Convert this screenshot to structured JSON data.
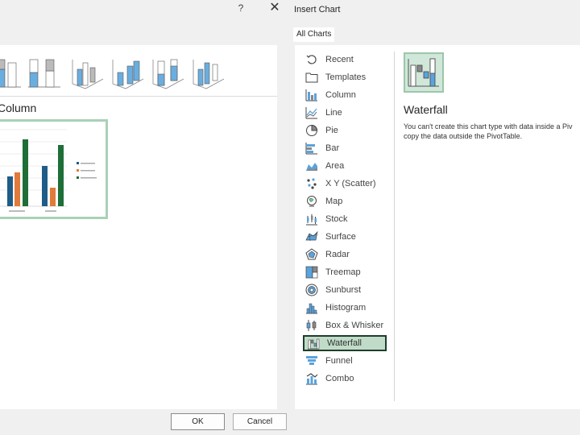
{
  "left_dialog": {
    "help_label": "?",
    "close_label": "✕",
    "heading": "Column",
    "ok_label": "OK",
    "cancel_label": "Cancel"
  },
  "right_dialog": {
    "title": "Insert Chart",
    "tab_label": "All Charts",
    "chart_types": [
      {
        "label": "Recent",
        "icon": "recent-icon"
      },
      {
        "label": "Templates",
        "icon": "templates-icon"
      },
      {
        "label": "Column",
        "icon": "column-chart-icon"
      },
      {
        "label": "Line",
        "icon": "line-chart-icon"
      },
      {
        "label": "Pie",
        "icon": "pie-chart-icon"
      },
      {
        "label": "Bar",
        "icon": "bar-chart-icon"
      },
      {
        "label": "Area",
        "icon": "area-chart-icon"
      },
      {
        "label": "X Y (Scatter)",
        "icon": "scatter-chart-icon"
      },
      {
        "label": "Map",
        "icon": "map-chart-icon"
      },
      {
        "label": "Stock",
        "icon": "stock-chart-icon"
      },
      {
        "label": "Surface",
        "icon": "surface-chart-icon"
      },
      {
        "label": "Radar",
        "icon": "radar-chart-icon"
      },
      {
        "label": "Treemap",
        "icon": "treemap-chart-icon"
      },
      {
        "label": "Sunburst",
        "icon": "sunburst-chart-icon"
      },
      {
        "label": "Histogram",
        "icon": "histogram-chart-icon"
      },
      {
        "label": "Box & Whisker",
        "icon": "box-whisker-chart-icon"
      },
      {
        "label": "Waterfall",
        "icon": "waterfall-chart-icon"
      },
      {
        "label": "Funnel",
        "icon": "funnel-chart-icon"
      },
      {
        "label": "Combo",
        "icon": "combo-chart-icon"
      }
    ],
    "selected_type": "Waterfall",
    "selected_name": "Waterfall",
    "description_line1": "You can't create this chart type with data inside a Piv",
    "description_line2": "copy the data outside the PivotTable."
  },
  "colors": {
    "selection_fill": "#c0dcc8",
    "selection_border": "#1f3d2c",
    "chart_blue": "#1f5c87",
    "chart_orange": "#e07b39",
    "chart_green": "#1e6e38"
  }
}
